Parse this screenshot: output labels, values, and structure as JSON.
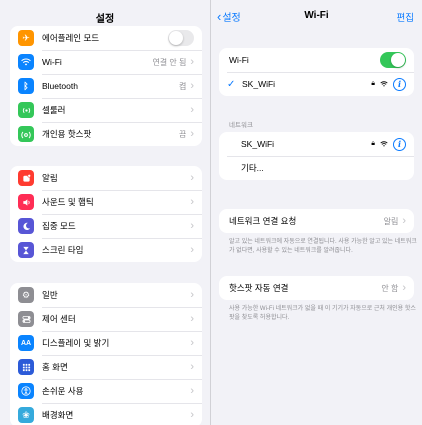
{
  "settings": {
    "title": "설정",
    "group1": [
      {
        "label": "에어플레인 모드",
        "icon": "airplane-icon",
        "color": "#ff9500",
        "toggle": false
      },
      {
        "label": "Wi-Fi",
        "icon": "wifi-icon",
        "color": "#0a84ff",
        "value": "연결 안 됨"
      },
      {
        "label": "Bluetooth",
        "icon": "bluetooth-icon",
        "color": "#0a84ff",
        "value": "켬"
      },
      {
        "label": "셀룰러",
        "icon": "cellular-icon",
        "color": "#34c759"
      },
      {
        "label": "개인용 핫스팟",
        "icon": "hotspot-icon",
        "color": "#34c759",
        "value": "끔"
      }
    ],
    "group2": [
      {
        "label": "알림",
        "icon": "notifications-icon",
        "color": "#ff3b30"
      },
      {
        "label": "사운드 및 햅틱",
        "icon": "sound-icon",
        "color": "#ff2d55"
      },
      {
        "label": "집중 모드",
        "icon": "focus-icon",
        "color": "#5856d6"
      },
      {
        "label": "스크린 타임",
        "icon": "screen-time-icon",
        "color": "#5856d6"
      }
    ],
    "group3": [
      {
        "label": "일반",
        "icon": "general-icon",
        "color": "#8e8e93"
      },
      {
        "label": "제어 센터",
        "icon": "control-center-icon",
        "color": "#8e8e93"
      },
      {
        "label": "디스플레이 및 밝기",
        "icon": "display-icon",
        "color": "#0a84ff"
      },
      {
        "label": "홈 화면",
        "icon": "home-screen-icon",
        "color": "#2c5bd8"
      },
      {
        "label": "손쉬운 사용",
        "icon": "accessibility-icon",
        "color": "#0a84ff"
      },
      {
        "label": "배경화면",
        "icon": "wallpaper-icon",
        "color": "#35aadc"
      }
    ]
  },
  "wifi": {
    "back_label": "설정",
    "title": "Wi-Fi",
    "edit_label": "편집",
    "wifi_label": "Wi-Fi",
    "wifi_on": true,
    "connected_network": "SK_WiFi",
    "networks_header": "네트워크",
    "networks": [
      "SK_WiFi",
      "기타..."
    ],
    "ask_join_label": "네트워크 연결 요청",
    "ask_join_value": "알림",
    "ask_join_footer": "알고 있는 네트워크에 자동으로 연결됩니다. 사용 가능한 알고 있는 네트워크가 없다면, 사용할 수 있는 네트워크를 알려줍니다.",
    "hotspot_label": "핫스팟 자동 연결",
    "hotspot_value": "안 함",
    "hotspot_footer": "사용 가능한 Wi-Fi 네트워크가 없을 때 이 기기가 자동으로 근처 개인용 핫스팟을 찾도록 허용합니다."
  }
}
